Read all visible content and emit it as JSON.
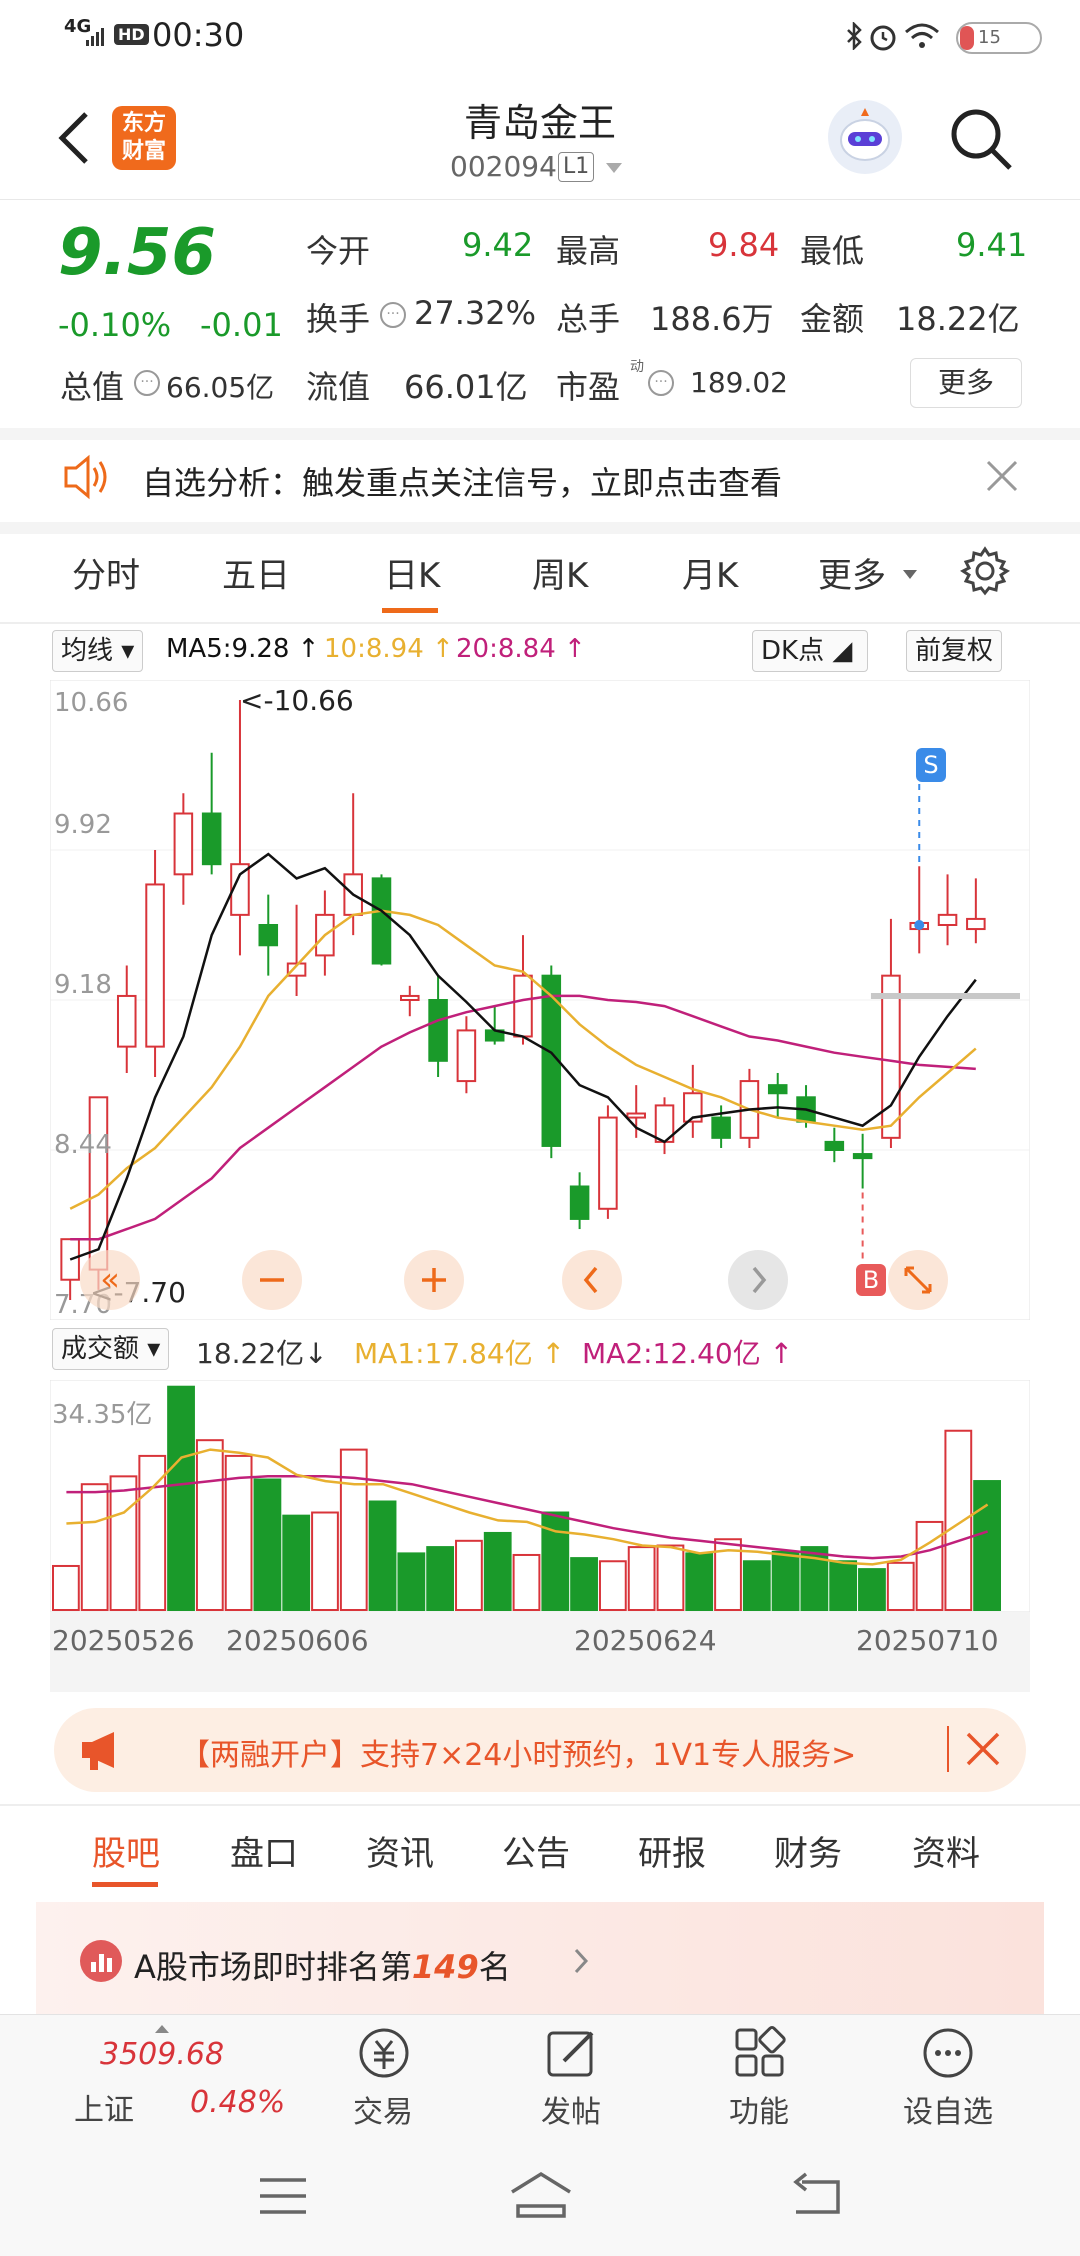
{
  "status": {
    "network": "4G",
    "hd": "HD",
    "time": "00:30",
    "battery": "15"
  },
  "header": {
    "logo_line1": "东方",
    "logo_line2": "财富",
    "title": "青岛金王",
    "code": "002094",
    "badge": "L1"
  },
  "quote": {
    "price": "9.56",
    "change_pct": "-0.10%",
    "change": "-0.01",
    "open_label": "今开",
    "open": "9.42",
    "high_label": "最高",
    "high": "9.84",
    "low_label": "最低",
    "low": "9.41",
    "turnover_label": "换手",
    "turnover": "27.32%",
    "volume_label": "总手",
    "volume": "188.6万",
    "amount_label": "金额",
    "amount": "18.22亿",
    "mcap_label": "总值",
    "mcap": "66.05亿",
    "float_label": "流值",
    "float": "66.01亿",
    "pe_label": "市盈",
    "pe_sup": "动",
    "pe": "189.02",
    "more": "更多"
  },
  "banner": {
    "text": "自选分析：触发重点关注信号，立即点击查看"
  },
  "tabs": [
    "分时",
    "五日",
    "日K",
    "周K",
    "月K",
    "更多"
  ],
  "active_tab": 2,
  "kline_tools": {
    "ma_select": "均线",
    "ma5": "MA5:9.28",
    "ma10": "10:8.94",
    "ma20": "20:8.84",
    "dk": "DK点",
    "fq": "前复权"
  },
  "kline_labels": {
    "top": "10.66",
    "l2": "9.92",
    "l3": "9.18",
    "l4": "8.44",
    "bottom": "7.70",
    "max_ann": "<-10.66",
    "min_ann": "<-7.70",
    "sell_mark": "S",
    "buy_mark": "B"
  },
  "volume_tools": {
    "select": "成交额",
    "value": "18.22亿",
    "ma1": "MA1:17.84亿",
    "ma2": "MA2:12.40亿",
    "top_label": "34.35亿"
  },
  "dates": [
    "20250526",
    "20250606",
    "20250624",
    "20250710"
  ],
  "ad": {
    "text": "【两融开户】支持7×24小时预约，1V1专人服务>"
  },
  "bottom_tabs": [
    "股吧",
    "盘口",
    "资讯",
    "公告",
    "研报",
    "财务",
    "资料"
  ],
  "rank": {
    "prefix": "A股市场即时排名第",
    "number": "149",
    "suffix": "名"
  },
  "footer": {
    "index_value": "3509.68",
    "index_name": "上证",
    "index_change": "0.48%",
    "trade": "交易",
    "post": "发帖",
    "func": "功能",
    "watch": "设自选"
  },
  "colors": {
    "up": "#d8343a",
    "down": "#1a9a2a",
    "ma5": "#111111",
    "ma10": "#e8b030",
    "ma20": "#c0207a",
    "accent": "#ee6a1a"
  },
  "chart_data": {
    "type": "candlestick",
    "y_range": [
      7.7,
      10.66
    ],
    "candles": [
      {
        "o": 7.8,
        "h": 8.0,
        "l": 7.7,
        "c": 8.0
      },
      {
        "o": 7.85,
        "h": 8.7,
        "l": 7.75,
        "c": 8.7
      },
      {
        "o": 8.95,
        "h": 9.35,
        "l": 8.82,
        "c": 9.2
      },
      {
        "o": 8.95,
        "h": 9.92,
        "l": 8.8,
        "c": 9.75
      },
      {
        "o": 9.8,
        "h": 10.2,
        "l": 9.65,
        "c": 10.1
      },
      {
        "o": 10.1,
        "h": 10.4,
        "l": 9.8,
        "c": 9.85
      },
      {
        "o": 9.6,
        "h": 10.66,
        "l": 9.4,
        "c": 9.85
      },
      {
        "o": 9.55,
        "h": 9.7,
        "l": 9.3,
        "c": 9.45
      },
      {
        "o": 9.3,
        "h": 9.65,
        "l": 9.2,
        "c": 9.36
      },
      {
        "o": 9.4,
        "h": 9.72,
        "l": 9.3,
        "c": 9.6
      },
      {
        "o": 9.6,
        "h": 10.2,
        "l": 9.5,
        "c": 9.8
      },
      {
        "o": 9.78,
        "h": 9.8,
        "l": 9.35,
        "c": 9.36
      },
      {
        "o": 9.18,
        "h": 9.25,
        "l": 9.1,
        "c": 9.2
      },
      {
        "o": 9.18,
        "h": 9.3,
        "l": 8.8,
        "c": 8.88
      },
      {
        "o": 8.78,
        "h": 9.1,
        "l": 8.72,
        "c": 9.03
      },
      {
        "o": 9.03,
        "h": 9.15,
        "l": 8.96,
        "c": 8.98
      },
      {
        "o": 9.0,
        "h": 9.5,
        "l": 8.96,
        "c": 9.3
      },
      {
        "o": 9.3,
        "h": 9.35,
        "l": 8.4,
        "c": 8.46
      },
      {
        "o": 8.26,
        "h": 8.33,
        "l": 8.05,
        "c": 8.1
      },
      {
        "o": 8.15,
        "h": 8.66,
        "l": 8.1,
        "c": 8.6
      },
      {
        "o": 8.6,
        "h": 8.76,
        "l": 8.5,
        "c": 8.62
      },
      {
        "o": 8.48,
        "h": 8.7,
        "l": 8.42,
        "c": 8.66
      },
      {
        "o": 8.58,
        "h": 8.86,
        "l": 8.5,
        "c": 8.72
      },
      {
        "o": 8.6,
        "h": 8.66,
        "l": 8.45,
        "c": 8.5
      },
      {
        "o": 8.5,
        "h": 8.84,
        "l": 8.45,
        "c": 8.78
      },
      {
        "o": 8.76,
        "h": 8.82,
        "l": 8.6,
        "c": 8.72
      },
      {
        "o": 8.7,
        "h": 8.76,
        "l": 8.55,
        "c": 8.58
      },
      {
        "o": 8.48,
        "h": 8.55,
        "l": 8.38,
        "c": 8.44
      },
      {
        "o": 8.42,
        "h": 8.52,
        "l": 8.25,
        "c": 8.4
      },
      {
        "o": 8.5,
        "h": 9.58,
        "l": 8.45,
        "c": 9.3
      },
      {
        "o": 9.53,
        "h": 9.84,
        "l": 9.41,
        "c": 9.56
      },
      {
        "o": 9.55,
        "h": 9.8,
        "l": 9.45,
        "c": 9.6
      },
      {
        "o": 9.53,
        "h": 9.78,
        "l": 9.46,
        "c": 9.58
      }
    ],
    "ma5": [
      7.9,
      7.95,
      8.3,
      8.7,
      9.0,
      9.5,
      9.8,
      9.9,
      9.78,
      9.83,
      9.7,
      9.62,
      9.5,
      9.3,
      9.17,
      9.03,
      9.0,
      8.92,
      8.76,
      8.7,
      8.55,
      8.48,
      8.6,
      8.62,
      8.64,
      8.65,
      8.64,
      8.6,
      8.56,
      8.66,
      8.9,
      9.1,
      9.28
    ],
    "ma10": [
      8.15,
      8.22,
      8.35,
      8.45,
      8.6,
      8.75,
      8.95,
      9.2,
      9.35,
      9.5,
      9.6,
      9.62,
      9.6,
      9.55,
      9.45,
      9.35,
      9.32,
      9.2,
      9.06,
      8.95,
      8.86,
      8.8,
      8.74,
      8.7,
      8.64,
      8.6,
      8.58,
      8.56,
      8.54,
      8.56,
      8.7,
      8.82,
      8.94
    ],
    "ma20": [
      8.0,
      8.0,
      8.05,
      8.1,
      8.2,
      8.3,
      8.45,
      8.55,
      8.65,
      8.75,
      8.85,
      8.95,
      9.02,
      9.08,
      9.12,
      9.15,
      9.18,
      9.2,
      9.2,
      9.18,
      9.17,
      9.15,
      9.1,
      9.05,
      9.0,
      8.98,
      8.95,
      8.92,
      8.9,
      8.88,
      8.86,
      8.85,
      8.84
    ],
    "sell_index": 30,
    "buy_index": 28,
    "volume": [
      2.8,
      8.0,
      8.5,
      9.8,
      14.2,
      10.8,
      9.8,
      8.3,
      6.0,
      6.2,
      10.2,
      6.9,
      3.6,
      4.0,
      4.4,
      4.9,
      3.5,
      6.2,
      3.3,
      3.1,
      4.0,
      4.1,
      3.6,
      4.5,
      3.1,
      3.7,
      4.0,
      3.1,
      2.6,
      3.0,
      5.6,
      11.4,
      8.2
    ],
    "volume_up": [
      true,
      true,
      true,
      true,
      false,
      true,
      true,
      false,
      false,
      true,
      true,
      false,
      false,
      false,
      true,
      false,
      true,
      false,
      false,
      true,
      true,
      true,
      false,
      true,
      false,
      false,
      false,
      false,
      false,
      true,
      true,
      true,
      false
    ],
    "vol_ma1": [
      5.5,
      5.6,
      6.2,
      7.8,
      9.7,
      10.2,
      10.0,
      9.7,
      8.6,
      8.2,
      8.0,
      8.0,
      7.4,
      6.8,
      6.2,
      5.7,
      5.6,
      5.0,
      4.8,
      4.5,
      4.1,
      4.0,
      3.6,
      3.8,
      3.7,
      3.5,
      3.3,
      3.0,
      2.9,
      3.2,
      4.3,
      5.5,
      6.7
    ],
    "vol_ma2": [
      7.5,
      7.5,
      7.6,
      7.8,
      8.0,
      8.2,
      8.4,
      8.5,
      8.5,
      8.5,
      8.4,
      8.2,
      8.0,
      7.6,
      7.2,
      6.8,
      6.4,
      6.0,
      5.6,
      5.2,
      4.9,
      4.6,
      4.4,
      4.2,
      4.0,
      3.8,
      3.6,
      3.4,
      3.3,
      3.4,
      3.8,
      4.4,
      5.0
    ],
    "vol_max": 14.5
  }
}
